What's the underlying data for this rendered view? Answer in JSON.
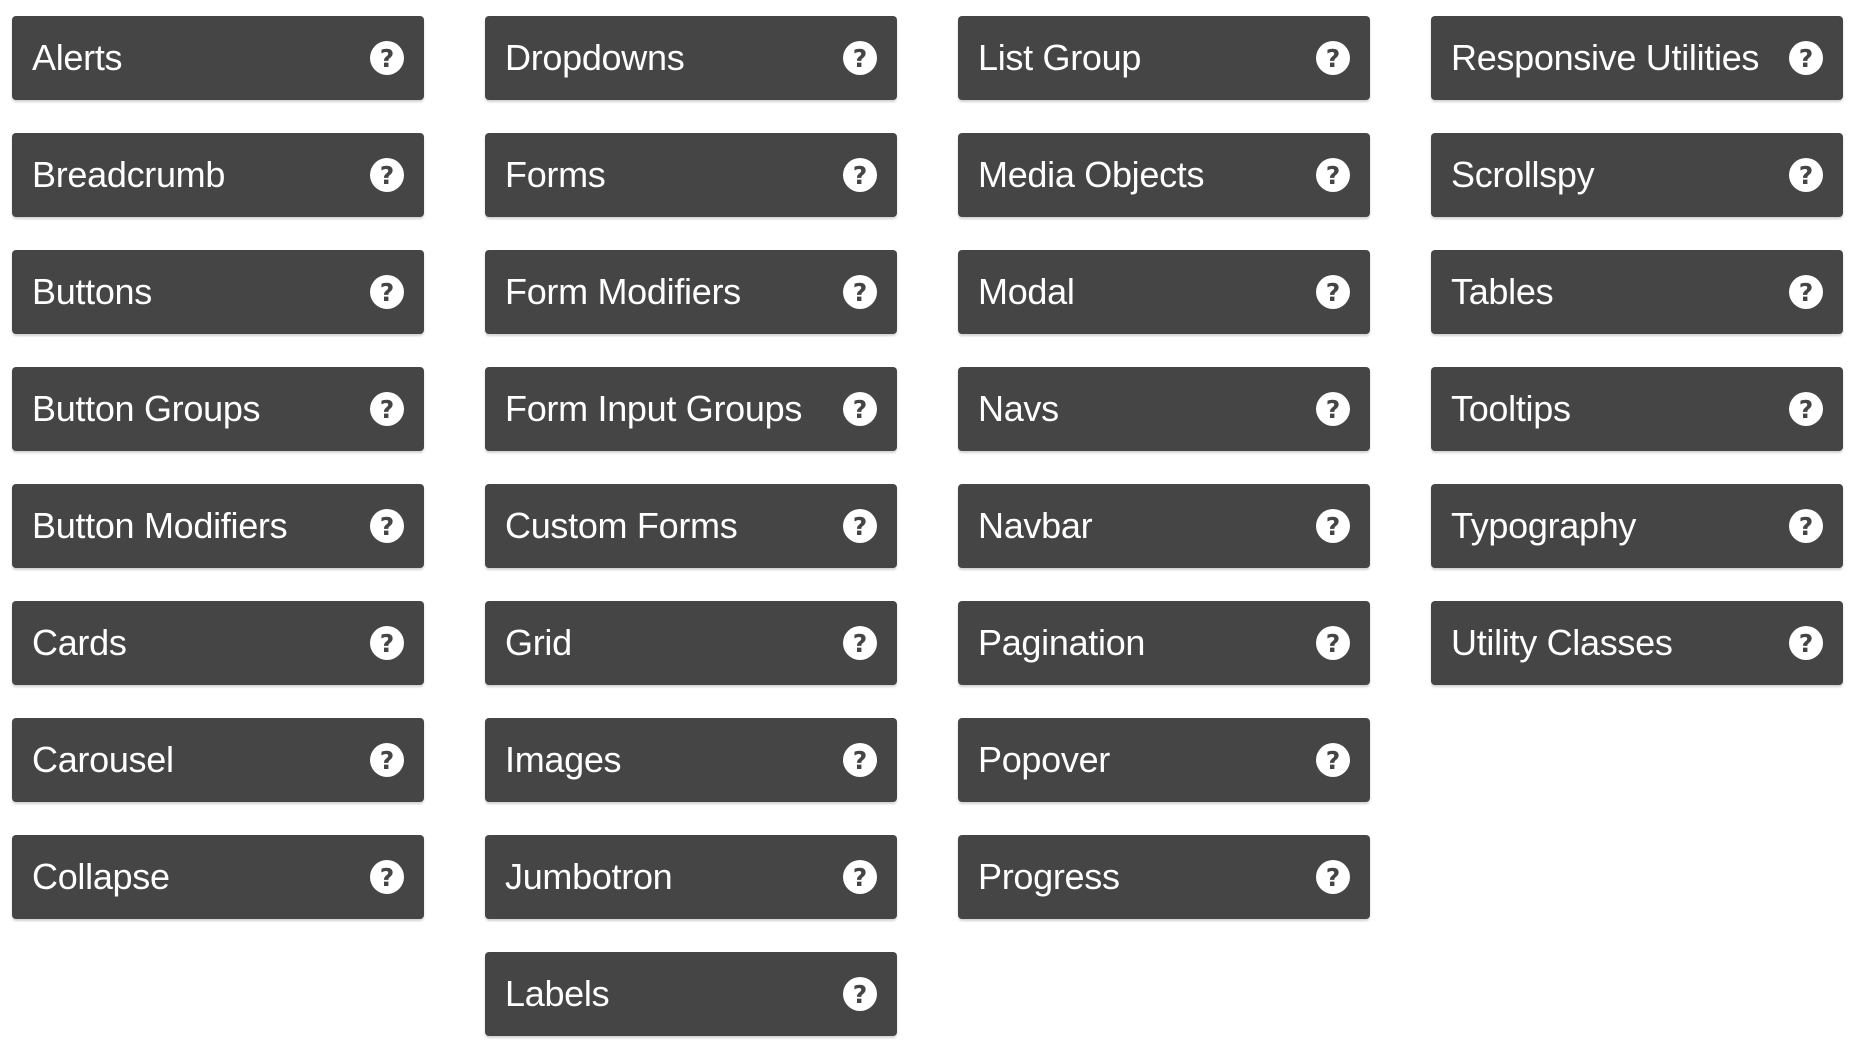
{
  "colors": {
    "tile_bg": "#454545",
    "tile_text": "#ffffff",
    "page_bg": "#ffffff"
  },
  "help_icon": {
    "name": "question-circle-icon",
    "glyph": "?"
  },
  "columns": [
    {
      "items": [
        "Alerts",
        "Breadcrumb",
        "Buttons",
        "Button Groups",
        "Button Modifiers",
        "Cards",
        "Carousel",
        "Collapse"
      ]
    },
    {
      "items": [
        "Dropdowns",
        "Forms",
        "Form Modifiers",
        "Form Input Groups",
        "Custom Forms",
        "Grid",
        "Images",
        "Jumbotron",
        "Labels"
      ]
    },
    {
      "items": [
        "List Group",
        "Media Objects",
        "Modal",
        "Navs",
        "Navbar",
        "Pagination",
        "Popover",
        "Progress"
      ]
    },
    {
      "items": [
        "Responsive Utilities",
        "Scrollspy",
        "Tables",
        "Tooltips",
        "Typography",
        "Utility Classes"
      ]
    }
  ]
}
